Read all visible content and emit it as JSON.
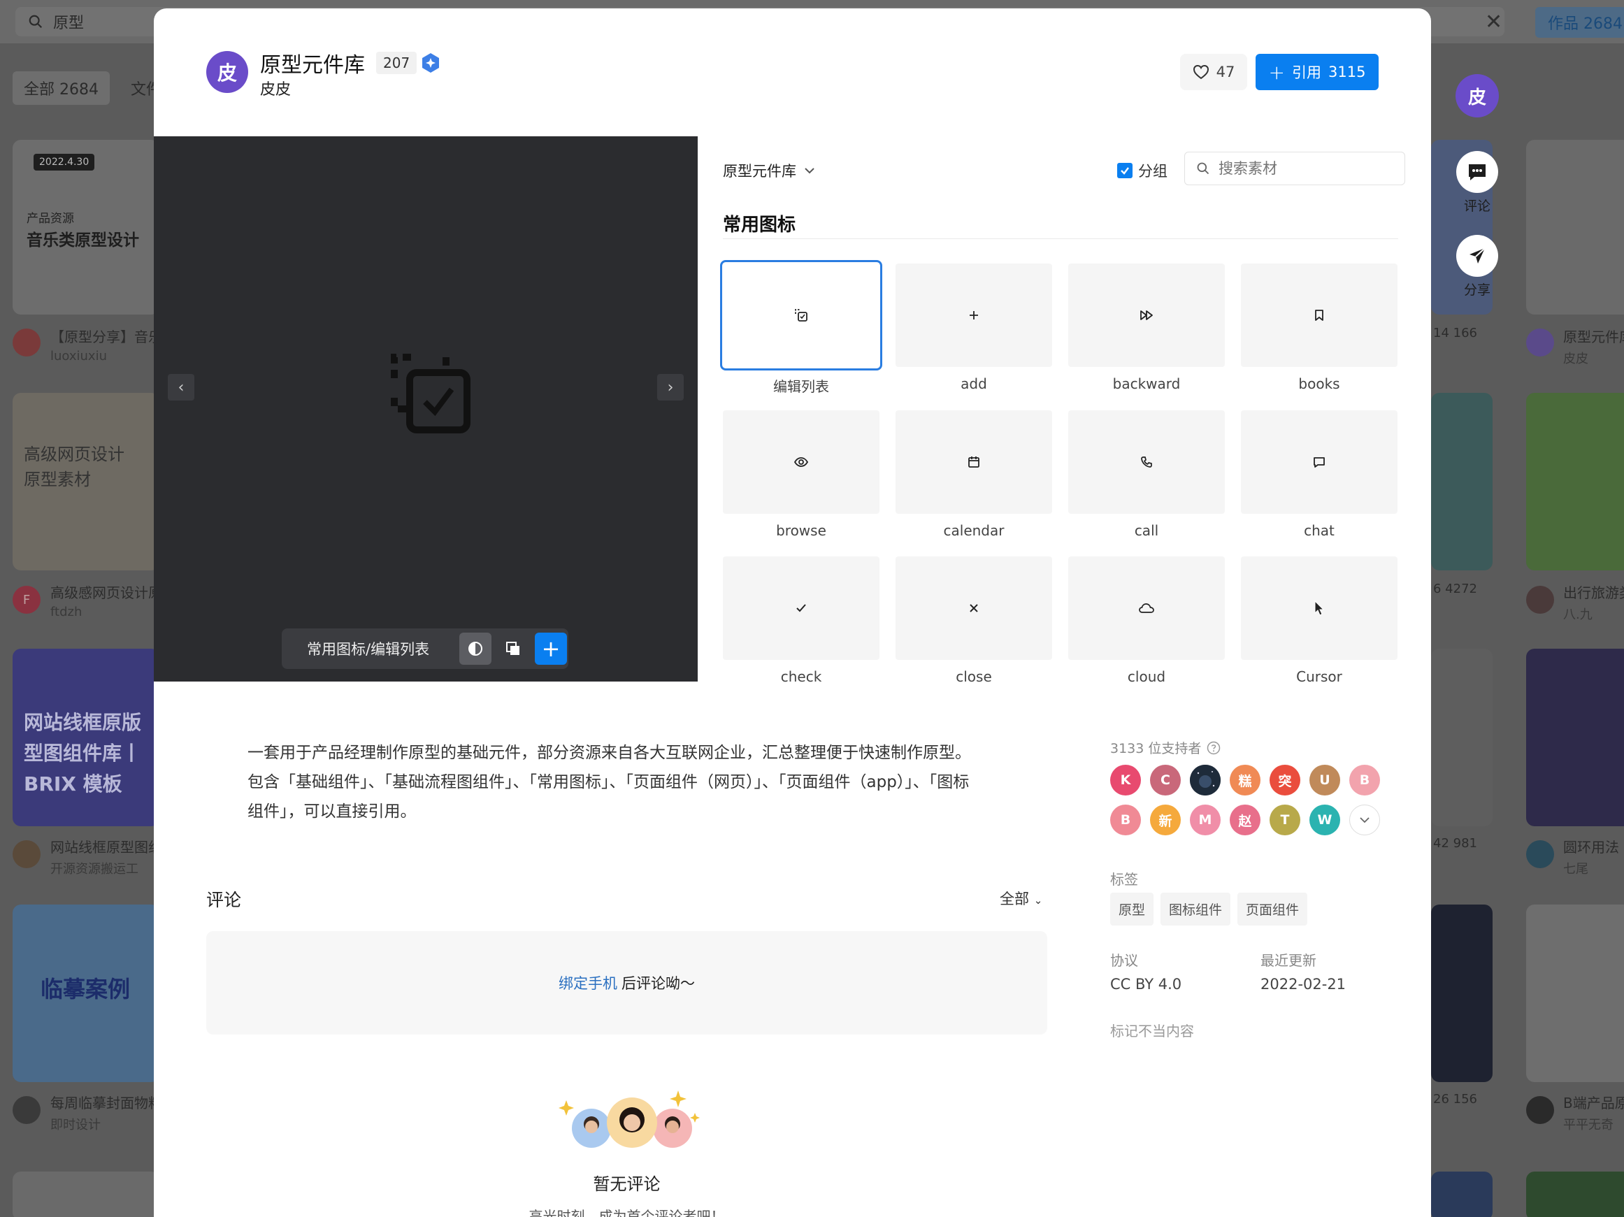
{
  "background": {
    "search_value": "原型",
    "works_label": "作品 2684",
    "filter_all": "全部 2684",
    "filter_file": "文件",
    "cards": [
      {
        "badge": "2022.4.30",
        "tag": "产品资源",
        "title": "音乐类原型设计",
        "caption": "【原型分享】音乐",
        "user": "luoxiuxiu"
      },
      {
        "title": "高级网页设计\n原型素材",
        "caption": "高级感网页设计原",
        "user": "ftdzh",
        "avatar_letter": "F"
      },
      {
        "title": "网站线框原版\n型图组件库丨\nBRIX 模板",
        "caption": "网站线框原型图组",
        "user": "开源资源搬运工"
      },
      {
        "title": "临摹案例",
        "caption": "每周临摹封面物料",
        "user": "即时设计"
      }
    ],
    "right_cards": [
      {
        "caption": "原型元件库",
        "user": "皮皮"
      },
      {
        "caption": "出行旅游类",
        "user": "八.九"
      },
      {
        "caption": "圆环用法",
        "user": "七尾"
      },
      {
        "caption": "B端产品原",
        "user": "平平无奇"
      }
    ],
    "mid_stats": [
      "14  166",
      "6  4272",
      "42  981",
      "26  156"
    ]
  },
  "header": {
    "avatar_letter": "皮",
    "title": "原型元件库",
    "count": "207",
    "author": "皮皮",
    "likes": "47",
    "cite_label": "引用",
    "cite_count": "3115"
  },
  "preview": {
    "path": "常用图标/编辑列表"
  },
  "panel": {
    "library": "原型元件库",
    "group_label": "分组",
    "search_placeholder": "搜索素材",
    "section_title": "常用图标",
    "tiles": [
      {
        "label": "编辑列表",
        "icon": "copy-edit-icon"
      },
      {
        "label": "add",
        "icon": "plus-icon"
      },
      {
        "label": "backward",
        "icon": "fast-forward-icon"
      },
      {
        "label": "books",
        "icon": "bookmark-icon"
      },
      {
        "label": "browse",
        "icon": "eye-icon"
      },
      {
        "label": "calendar",
        "icon": "calendar-icon"
      },
      {
        "label": "call",
        "icon": "phone-icon"
      },
      {
        "label": "chat",
        "icon": "chat-icon"
      },
      {
        "label": "check",
        "icon": "check-icon"
      },
      {
        "label": "close",
        "icon": "close-icon"
      },
      {
        "label": "cloud",
        "icon": "cloud-icon"
      },
      {
        "label": "Cursor",
        "icon": "cursor-icon"
      }
    ]
  },
  "description": "一套用于产品经理制作原型的基础元件，部分资源来自各大互联网企业，汇总整理便于快速制作原型。包含「基础组件」、「基础流程图组件」、「常用图标」、「页面组件（网页）」、「页面组件（app）」、「图标组件」，可以直接引用。",
  "comments": {
    "title": "评论",
    "sort": "全部",
    "bind_link": "绑定手机",
    "bind_text": "后评论呦～",
    "empty_title": "暂无评论",
    "empty_sub": "高光时刻，成为首个评论者吧！"
  },
  "sidebar": {
    "supporters": "3133 位支持者",
    "supporter_avatars": [
      {
        "letter": "K",
        "color": "#e84a6f"
      },
      {
        "letter": "C",
        "color": "#c9687a"
      },
      {
        "letter": "",
        "color": "#1e2b3a"
      },
      {
        "letter": "糕",
        "color": "#f08a55"
      },
      {
        "letter": "突",
        "color": "#ea4d3d"
      },
      {
        "letter": "U",
        "color": "#c08a5a"
      },
      {
        "letter": "B",
        "color": "#f2a3ad"
      },
      {
        "letter": "B",
        "color": "#f08a95"
      },
      {
        "letter": "新",
        "color": "#f5a93c"
      },
      {
        "letter": "M",
        "color": "#f08ea8"
      },
      {
        "letter": "赵",
        "color": "#e86f8b"
      },
      {
        "letter": "T",
        "color": "#b8a94a"
      },
      {
        "letter": "W",
        "color": "#2bb3b0"
      }
    ],
    "tags_label": "标签",
    "tags": [
      "原型",
      "图标组件",
      "页面组件"
    ],
    "license_label": "协议",
    "license": "CC BY 4.0",
    "updated_label": "最近更新",
    "updated": "2022-02-21",
    "report": "标记不当内容"
  },
  "float_actions": {
    "avatar_letter": "皮",
    "comment": "评论",
    "share": "分享"
  },
  "colors": {
    "accent": "#0a7ff0",
    "avatar": "#6a4cc9"
  }
}
